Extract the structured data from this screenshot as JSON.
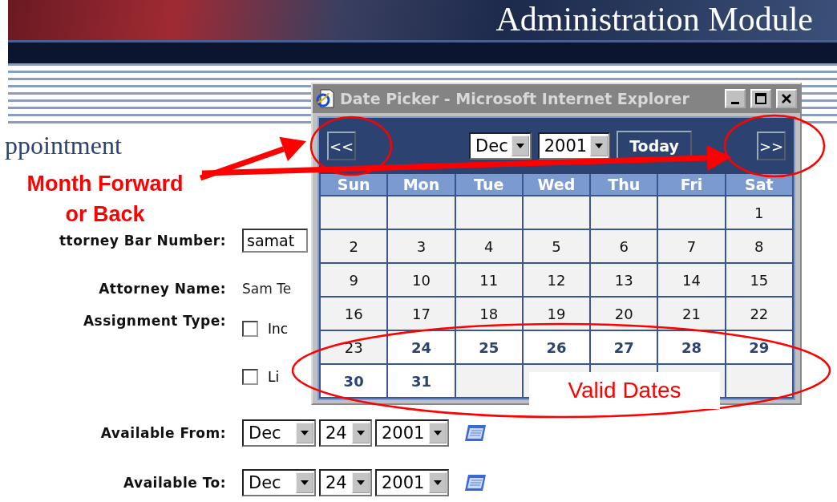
{
  "header": {
    "title": "Administration Module"
  },
  "page_title": "ppointment",
  "form": {
    "rows": [
      {
        "kind": "text",
        "label": "ttorney Bar Number:",
        "value": "samat"
      },
      {
        "kind": "plain",
        "label": "Attorney Name:",
        "value": "Sam Te"
      },
      {
        "kind": "checks",
        "label": "Assignment Type:",
        "options": [
          {
            "label": "Inc",
            "checked": false
          },
          {
            "label": "Li",
            "checked": false
          }
        ]
      },
      {
        "kind": "date",
        "label": "Available From:",
        "month": "Dec",
        "day": "24",
        "year": "2001"
      },
      {
        "kind": "date",
        "label": "Available To:",
        "month": "Dec",
        "day": "24",
        "year": "2001"
      }
    ]
  },
  "date_picker": {
    "title": "Date Picker - Microsoft Internet Explorer",
    "prev": "<<",
    "next": ">>",
    "month": "Dec",
    "year": "2001",
    "today": "Today",
    "weekdays": [
      "Sun",
      "Mon",
      "Tue",
      "Wed",
      "Thu",
      "Fri",
      "Sat"
    ],
    "weeks": [
      [
        {
          "valid": false
        },
        {
          "valid": false
        },
        {
          "valid": false
        },
        {
          "valid": false
        },
        {
          "valid": false
        },
        {
          "valid": false
        },
        {
          "day": "1",
          "valid": false
        }
      ],
      [
        {
          "day": "2",
          "valid": false
        },
        {
          "day": "3",
          "valid": false
        },
        {
          "day": "4",
          "valid": false
        },
        {
          "day": "5",
          "valid": false
        },
        {
          "day": "6",
          "valid": false
        },
        {
          "day": "7",
          "valid": false
        },
        {
          "day": "8",
          "valid": false
        }
      ],
      [
        {
          "day": "9",
          "valid": false
        },
        {
          "day": "10",
          "valid": false
        },
        {
          "day": "11",
          "valid": false
        },
        {
          "day": "12",
          "valid": false
        },
        {
          "day": "13",
          "valid": false
        },
        {
          "day": "14",
          "valid": false
        },
        {
          "day": "15",
          "valid": false
        }
      ],
      [
        {
          "day": "16",
          "valid": false
        },
        {
          "day": "17",
          "valid": false
        },
        {
          "day": "18",
          "valid": false
        },
        {
          "day": "19",
          "valid": false
        },
        {
          "day": "20",
          "valid": false
        },
        {
          "day": "21",
          "valid": false
        },
        {
          "day": "22",
          "valid": false
        }
      ],
      [
        {
          "day": "23",
          "valid": false
        },
        {
          "day": "24",
          "valid": true
        },
        {
          "day": "25",
          "valid": true
        },
        {
          "day": "26",
          "valid": true
        },
        {
          "day": "27",
          "valid": true
        },
        {
          "day": "28",
          "valid": true
        },
        {
          "day": "29",
          "valid": true
        }
      ],
      [
        {
          "day": "30",
          "valid": true
        },
        {
          "day": "31",
          "valid": true
        },
        {
          "valid": false
        },
        {
          "valid": false
        },
        {
          "valid": false
        },
        {
          "valid": false
        },
        {
          "valid": false
        }
      ]
    ]
  },
  "annotations": {
    "nav_note": "Month Forward or Back",
    "dates_note": "Valid Dates"
  }
}
